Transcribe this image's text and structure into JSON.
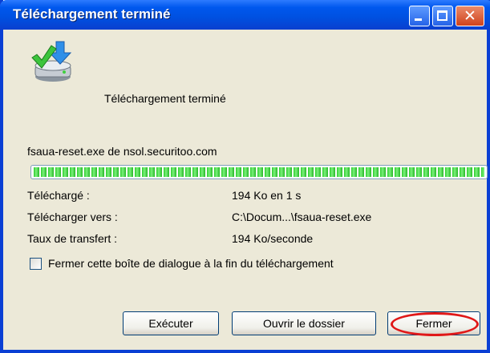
{
  "window": {
    "title": "Téléchargement terminé"
  },
  "header": {
    "text": "Téléchargement terminé",
    "icon": "download-complete-icon"
  },
  "download": {
    "filename": "fsaua-reset.exe de nsol.securitoo.com",
    "progress_fraction": 1.0,
    "details": [
      {
        "label": "Téléchargé :",
        "value": "194 Ko en 1 s"
      },
      {
        "label": "Télécharger vers :",
        "value": "C:\\Docum...\\fsaua-reset.exe"
      },
      {
        "label": "Taux de transfert :",
        "value": "194 Ko/seconde"
      }
    ]
  },
  "checkbox": {
    "label": "Fermer cette boîte de dialogue à la fin du téléchargement",
    "checked": false
  },
  "buttons": {
    "execute": "Exécuter",
    "open_folder": "Ouvrir le dossier",
    "close": "Fermer"
  },
  "colors": {
    "title_bar": "#0058ee",
    "dialog_bg": "#ece9d8",
    "progress_green": "#2bcc2b",
    "highlight_red": "#e01818"
  }
}
